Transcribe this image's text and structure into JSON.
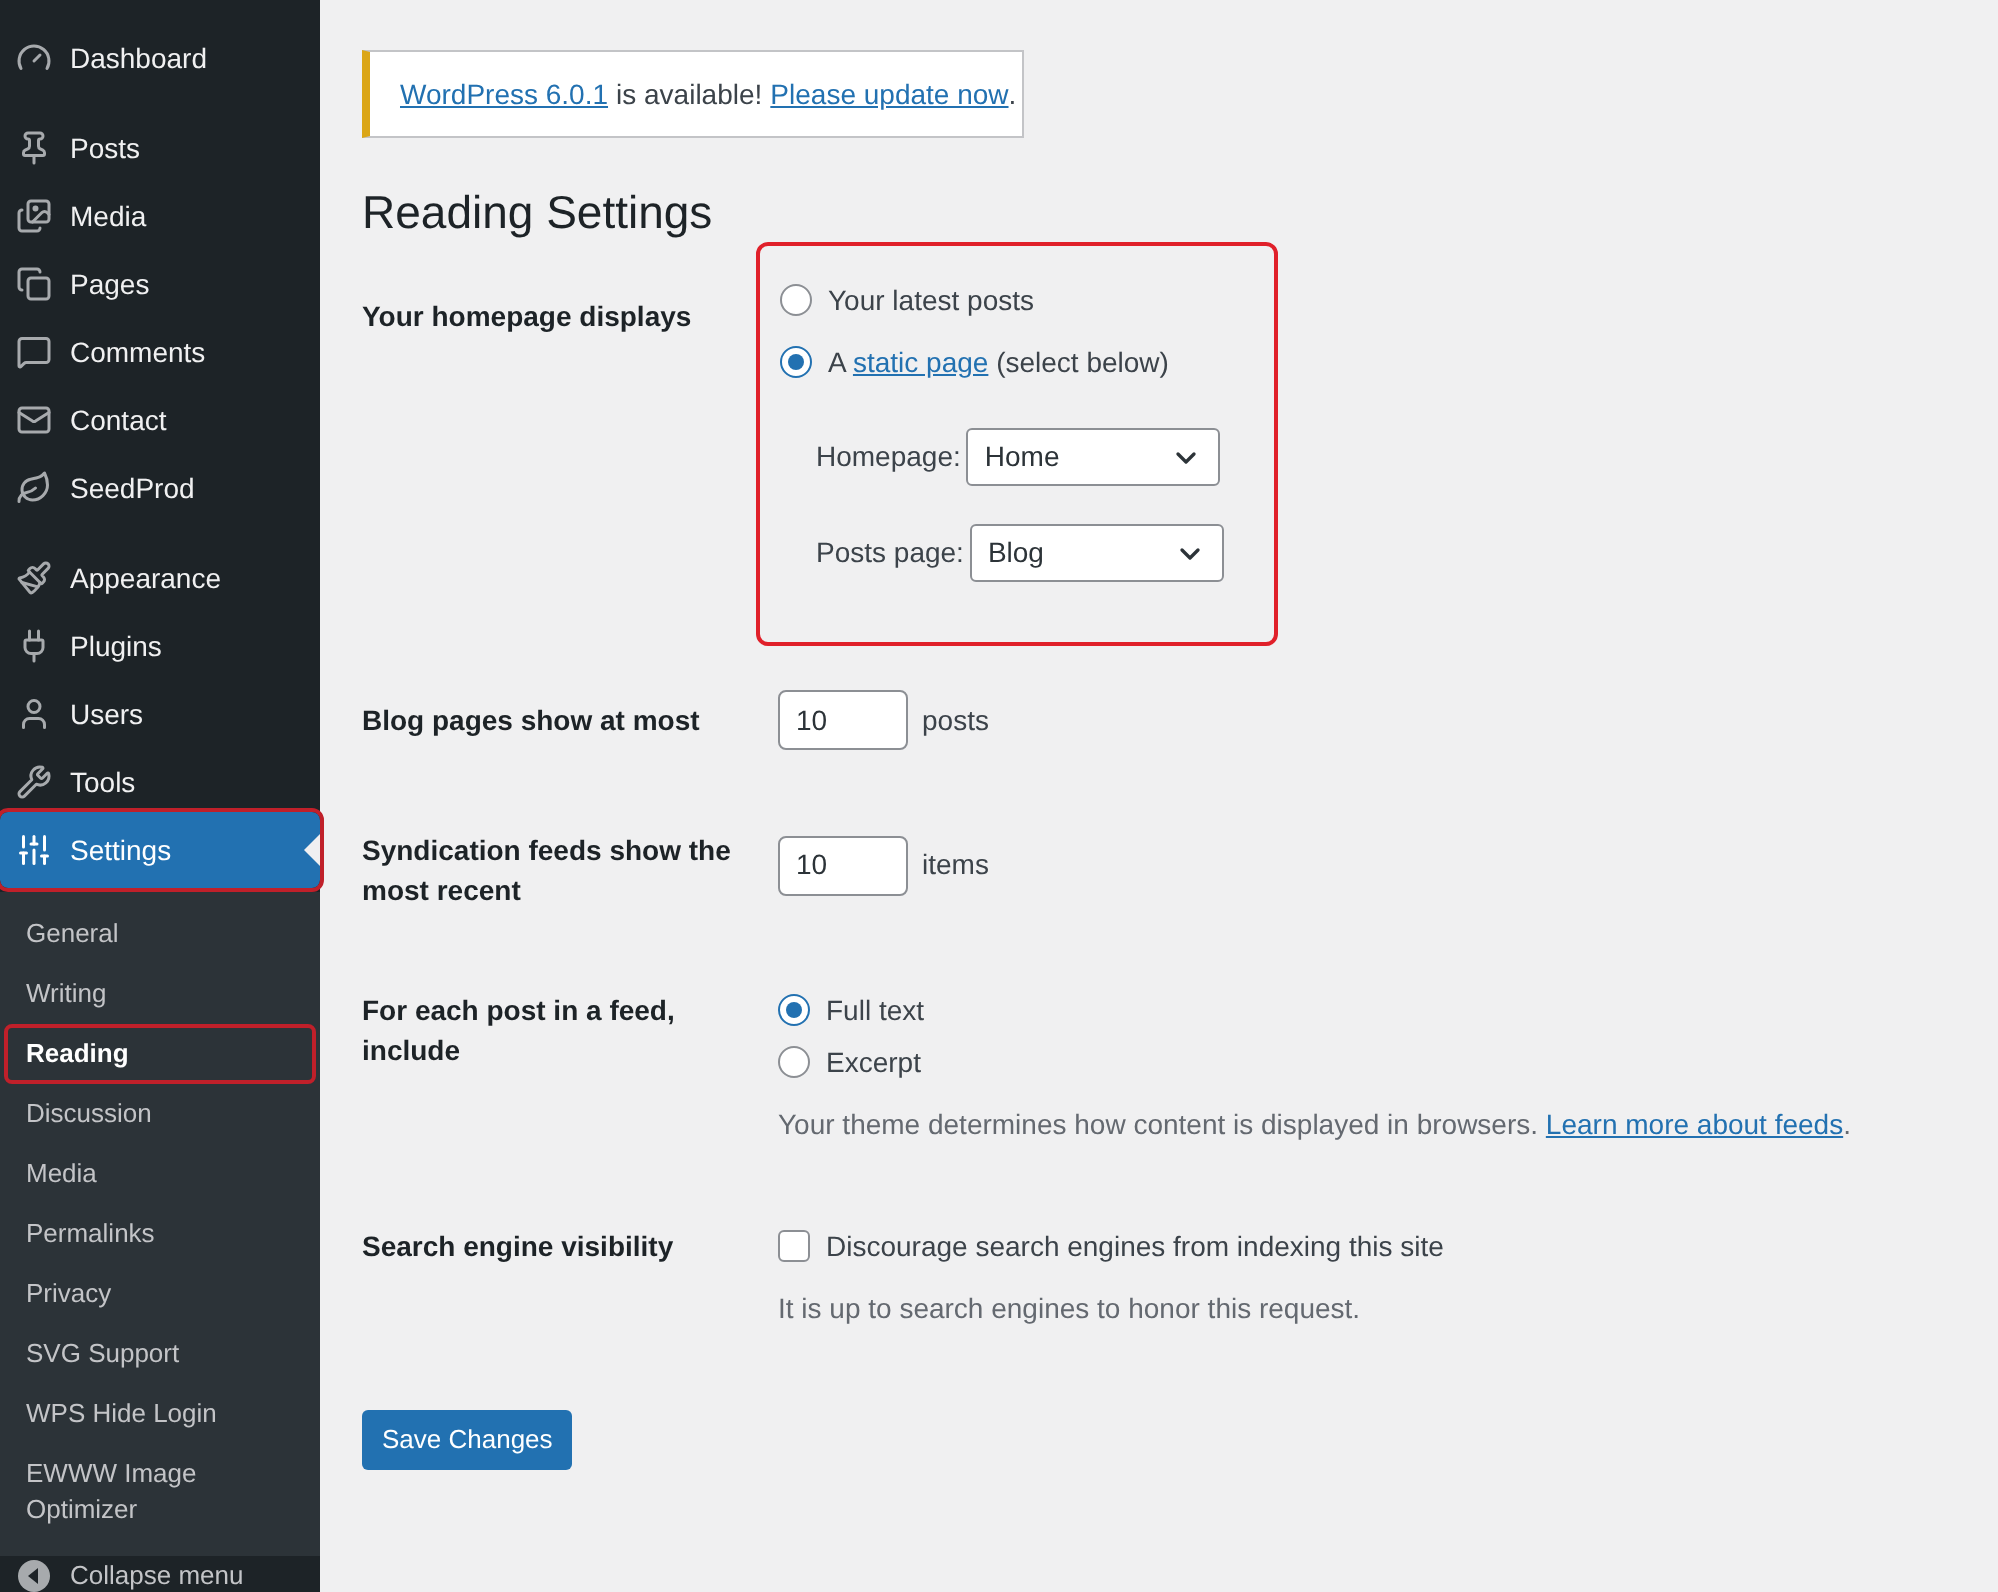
{
  "sidebar": {
    "menu_groups": [
      [
        {
          "label": "Dashboard",
          "selected": false,
          "highlighted": false
        }
      ],
      [
        {
          "label": "Posts",
          "selected": false,
          "highlighted": false
        },
        {
          "label": "Media",
          "selected": false,
          "highlighted": false
        },
        {
          "label": "Pages",
          "selected": false,
          "highlighted": false
        },
        {
          "label": "Comments",
          "selected": false,
          "highlighted": false
        },
        {
          "label": "Contact",
          "selected": false,
          "highlighted": false
        },
        {
          "label": "SeedProd",
          "selected": false,
          "highlighted": false
        }
      ],
      [
        {
          "label": "Appearance",
          "selected": false,
          "highlighted": false
        },
        {
          "label": "Plugins",
          "selected": false,
          "highlighted": false
        },
        {
          "label": "Users",
          "selected": false,
          "highlighted": false
        },
        {
          "label": "Tools",
          "selected": false,
          "highlighted": false
        },
        {
          "label": "Settings",
          "selected": true,
          "highlighted": true
        }
      ]
    ],
    "submenu": [
      {
        "label": "General",
        "selected": false,
        "highlighted": false
      },
      {
        "label": "Writing",
        "selected": false,
        "highlighted": false
      },
      {
        "label": "Reading",
        "selected": true,
        "highlighted": true
      },
      {
        "label": "Discussion",
        "selected": false,
        "highlighted": false
      },
      {
        "label": "Media",
        "selected": false,
        "highlighted": false
      },
      {
        "label": "Permalinks",
        "selected": false,
        "highlighted": false
      },
      {
        "label": "Privacy",
        "selected": false,
        "highlighted": false
      },
      {
        "label": "SVG Support",
        "selected": false,
        "highlighted": false
      },
      {
        "label": "WPS Hide Login",
        "selected": false,
        "highlighted": false
      },
      {
        "label": "EWWW Image Optimizer",
        "selected": false,
        "highlighted": false
      }
    ],
    "collapse": "Collapse menu"
  },
  "notice": {
    "link_1": "WordPress 6.0.1",
    "text": "is available!",
    "link_2": "Please update now",
    "end": "."
  },
  "title": "Reading Settings",
  "rows": [
    {
      "kind": "homepage",
      "label": "Your homepage displays",
      "highlighted": true,
      "options": [
        {
          "text": "Your latest posts",
          "selected": false
        },
        {
          "text": "A",
          "link": "static page",
          "text_after": "(select below)",
          "selected": true
        }
      ],
      "selects": [
        {
          "label": "Homepage:",
          "value": "Home"
        },
        {
          "label": "Posts page:",
          "value": "Blog"
        }
      ]
    },
    {
      "kind": "number",
      "label": "Blog pages show at most",
      "value": "10",
      "unit": "posts"
    },
    {
      "kind": "number",
      "label": "Syndication feeds show the most recent",
      "value": "10",
      "unit": "items"
    },
    {
      "kind": "radios",
      "label": "For each post in a feed, include",
      "options": [
        {
          "text": "Full text",
          "selected": true
        },
        {
          "text": "Excerpt",
          "selected": false
        }
      ],
      "note": "Your theme determines how content is displayed in browsers.",
      "note_link": "Learn more about feeds",
      "note_end": "."
    },
    {
      "kind": "checkbox",
      "label": "Search engine visibility",
      "text": "Discourage search engines from indexing this site",
      "checked": false,
      "note": "It is up to search engines to honor this request."
    }
  ],
  "save_button": "Save Changes"
}
